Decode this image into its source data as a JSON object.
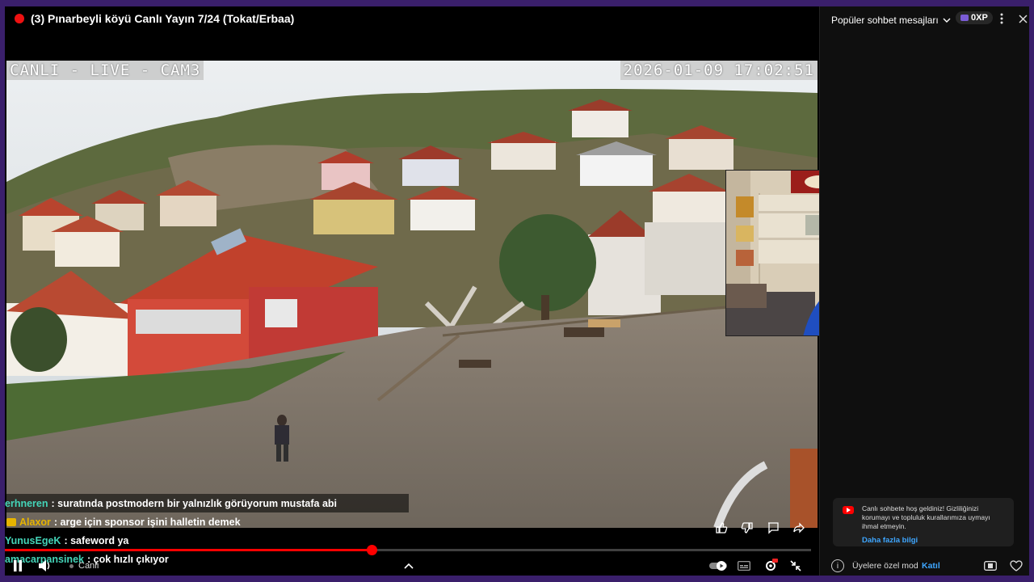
{
  "player": {
    "title": "(3) Pınarbeyli köyü Canlı Yayın 7/24 (Tokat/Erbaa)",
    "cam_label": "CANLI - LIVE - CAM3",
    "cam_timestamp": "2026-01-09 17:02:51",
    "live_label": "Canlı",
    "progress_fraction": 0.455
  },
  "overlay_chat": [
    {
      "user": "erhneren",
      "text": ": suratında postmodern bir yalnızlık görüyorum mustafa abi",
      "color": "#44d4b8",
      "badge": false
    },
    {
      "user": "Alaxor",
      "text": ": arge için sponsor işini halletin demek",
      "color": "#e6b400",
      "badge": true
    },
    {
      "user": "YunusEgeK",
      "text": ": safeword ya",
      "color": "#44d4b8",
      "badge": false
    },
    {
      "user": "amacarpansinek",
      "text": ": çok hızlı çıkıyor",
      "color": "#44d4b8",
      "badge": false
    }
  ],
  "chat_panel": {
    "header_title": "Popüler sohbet mesajları",
    "xp_label": "0XP",
    "welcome_message": "Canlı sohbete hoş geldiniz! Gizliliğinizi korumayı ve topluluk kurallarımıza uymayı ihmal etmeyin.",
    "learn_more": "Daha fazla bilgi",
    "members_mode": "Üyelere özel mod",
    "join_label": "Katıl"
  },
  "colors": {
    "frame": "#3a1f6b",
    "accent_red": "#ff0000",
    "link_blue": "#3ea6ff"
  }
}
